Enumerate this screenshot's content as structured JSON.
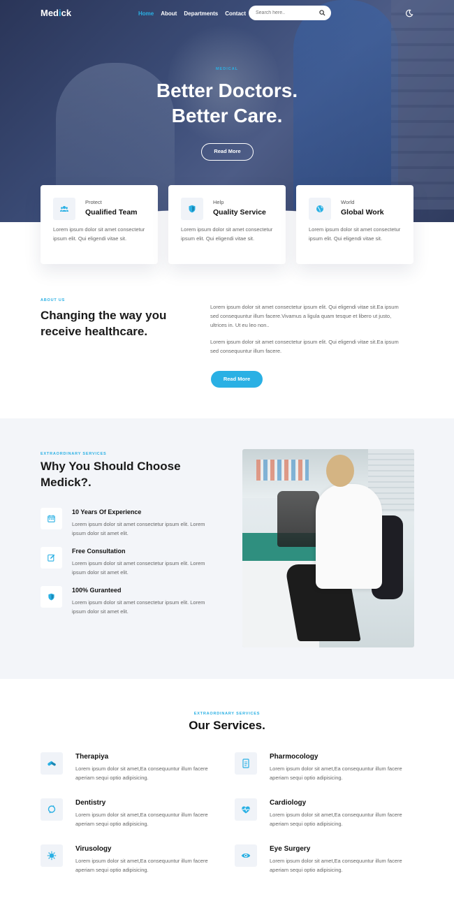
{
  "header": {
    "logo_prefix": "Med",
    "logo_accent": "i",
    "logo_suffix": "ck",
    "nav": [
      "Home",
      "About",
      "Departments",
      "Contact"
    ],
    "active_nav": "Home",
    "search_placeholder": "Search here..",
    "theme_toggle_icon": "moon-icon"
  },
  "hero": {
    "eyebrow": "MEDICAL",
    "title_line1": "Better Doctors.",
    "title_line2": "Better Care.",
    "button": "Read More"
  },
  "features": [
    {
      "tag": "Protect",
      "title": "Qualified Team",
      "icon": "team-icon",
      "text": "Lorem ipsum dolor sit amet consectetur ipsum elit. Qui eligendi vitae sit."
    },
    {
      "tag": "Help",
      "title": "Quality Service",
      "icon": "shield-icon",
      "text": "Lorem ipsum dolor sit amet consectetur ipsum elit. Qui eligendi vitae sit."
    },
    {
      "tag": "World",
      "title": "Global Work",
      "icon": "globe-icon",
      "text": "Lorem ipsum dolor sit amet consectetur ipsum elit. Qui eligendi vitae sit."
    }
  ],
  "about": {
    "eyebrow": "ABOUT US",
    "title": "Changing the way you receive healthcare.",
    "p1": "Lorem ipsum dolor sit amet consectetur ipsum elit. Qui eligendi vitae sit.Ea ipsum sed consequuntur illum facere.Vivamus a ligula quam tesque et libero ut justo, ultrices in. Ut eu leo non..",
    "p2": "Lorem ipsum dolor sit amet consectetur ipsum elit. Qui eligendi vitae sit.Ea ipsum sed consequuntur illum facere.",
    "button": "Read More"
  },
  "why": {
    "eyebrow": "EXTRAORDINARY SERVICES",
    "title": "Why You Should Choose Medick?.",
    "items": [
      {
        "title": "10 Years Of Experience",
        "icon": "calendar-icon",
        "text": "Lorem ipsum dolor sit amet consectetur ipsum elit. Lorem ipsum dolor sit amet elit."
      },
      {
        "title": "Free Consultation",
        "icon": "edit-icon",
        "text": "Lorem ipsum dolor sit amet consectetur ipsum elit. Lorem ipsum dolor sit amet elit."
      },
      {
        "title": "100% Guranteed",
        "icon": "shield-icon",
        "text": "Lorem ipsum dolor sit amet consectetur ipsum elit. Lorem ipsum dolor sit amet elit."
      }
    ]
  },
  "services": {
    "eyebrow": "EXTRAORDINARY SERVICES",
    "title": "Our Services.",
    "items": [
      {
        "title": "Therapiya",
        "icon": "capsules-icon",
        "text": "Lorem ipsum dolor sit amet,Ea consequuntur illum facere aperiam sequi optio adipisicing."
      },
      {
        "title": "Pharmocology",
        "icon": "prescription-icon",
        "text": "Lorem ipsum dolor sit amet,Ea consequuntur illum facere aperiam sequi optio adipisicing."
      },
      {
        "title": "Dentistry",
        "icon": "tooth-icon",
        "text": "Lorem ipsum dolor sit amet,Ea consequuntur illum facere aperiam sequi optio adipisicing."
      },
      {
        "title": "Cardiology",
        "icon": "heartbeat-icon",
        "text": "Lorem ipsum dolor sit amet,Ea consequuntur illum facere aperiam sequi optio adipisicing."
      },
      {
        "title": "Virusology",
        "icon": "virus-icon",
        "text": "Lorem ipsum dolor sit amet,Ea consequuntur illum facere aperiam sequi optio adipisicing."
      },
      {
        "title": "Eye Surgery",
        "icon": "eye-icon",
        "text": "Lorem ipsum dolor sit amet,Ea consequuntur illum facere aperiam sequi optio adipisicing."
      }
    ]
  },
  "colors": {
    "accent": "#2ab0e4",
    "hero_overlay": "#2f3b5e",
    "section_bg": "#f3f5f9"
  }
}
